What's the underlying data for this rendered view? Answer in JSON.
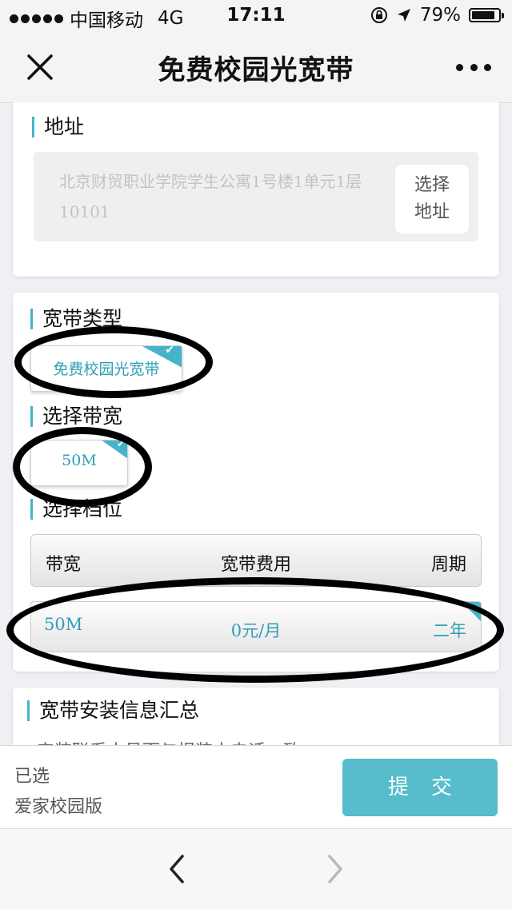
{
  "status_bar": {
    "carrier": "中国移动",
    "network": "4G",
    "time": "17:11",
    "battery": "79%"
  },
  "nav": {
    "title": "免费校园光宽带"
  },
  "address_section": {
    "heading": "地址",
    "address_value": "北京财贸职业学院学生公寓1号楼1单元1层10101",
    "select_button": "选择地址"
  },
  "broadband_section": {
    "type_heading": "宽带类型",
    "type_option": "免费校园光宽带",
    "bandwidth_heading": "选择带宽",
    "bandwidth_option": "50M",
    "tier_heading": "选择档位",
    "table_headers": {
      "bandwidth": "带宽",
      "fee": "宽带费用",
      "period": "周期"
    },
    "table_row": {
      "bandwidth": "50M",
      "fee": "0元/月",
      "period": "二年"
    }
  },
  "summary_section": {
    "heading": "宽带安装信息汇总",
    "partial_text": "安装联系人号而与报装人电话一致"
  },
  "bottom_bar": {
    "selected_label": "已选",
    "selected_value": "爱家校园版",
    "submit_label": "提交"
  },
  "colors": {
    "accent": "#45b4c9",
    "submit": "#57bccb"
  }
}
